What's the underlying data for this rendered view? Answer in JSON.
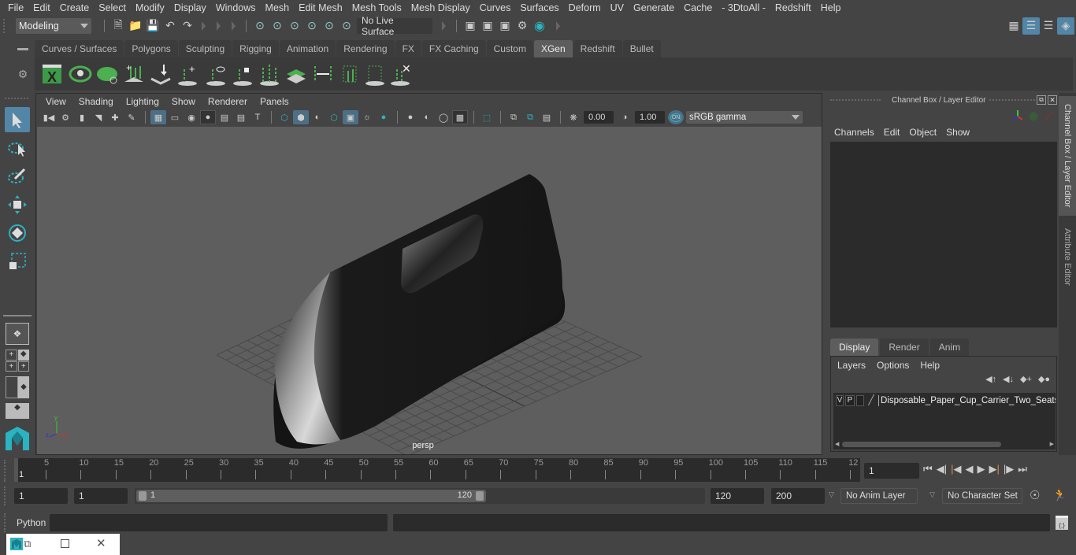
{
  "menubar": {
    "items": [
      "File",
      "Edit",
      "Create",
      "Select",
      "Modify",
      "Display",
      "Windows",
      "Mesh",
      "Edit Mesh",
      "Mesh Tools",
      "Mesh Display",
      "Curves",
      "Surfaces",
      "Deform",
      "UV",
      "Generate",
      "Cache",
      "- 3DtoAll -",
      "Redshift",
      "Help"
    ]
  },
  "statusline": {
    "mode": "Modeling",
    "live_surface": "No Live Surface"
  },
  "shelf": {
    "tabs": [
      "Curves / Surfaces",
      "Polygons",
      "Sculpting",
      "Rigging",
      "Animation",
      "Rendering",
      "FX",
      "FX Caching",
      "Custom",
      "XGen",
      "Redshift",
      "Bullet"
    ],
    "active_tab": "XGen",
    "icons": [
      "xgen-editor-icon",
      "xgen-preview-icon",
      "xgen-clear-preview-icon",
      "add-guides-icon",
      "place-guides-icon",
      "add-guide-icon",
      "toggle-guide-visibility-icon",
      "lock-guide-icon",
      "guide-mid-icon",
      "density-map-icon",
      "flip-guides-icon",
      "select-guides-icon",
      "guide-cv-icon",
      "delete-guides-icon"
    ]
  },
  "viewport": {
    "menu": [
      "View",
      "Shading",
      "Lighting",
      "Show",
      "Renderer",
      "Panels"
    ],
    "exposure": "0.00",
    "gamma": "1.00",
    "color_management": "ON",
    "color_space": "sRGB gamma",
    "camera_label": "persp",
    "axis": {
      "x": "x",
      "y": "y",
      "z": "z"
    }
  },
  "channel_box": {
    "title": "Channel Box / Layer Editor",
    "menu": [
      "Channels",
      "Edit",
      "Object",
      "Show"
    ]
  },
  "layer_editor": {
    "tabs": [
      "Display",
      "Render",
      "Anim"
    ],
    "active_tab": "Display",
    "menu": [
      "Layers",
      "Options",
      "Help"
    ],
    "layers": [
      {
        "v": "V",
        "p": "P",
        "name": "Disposable_Paper_Cup_Carrier_Two_Seats_I"
      }
    ]
  },
  "side_tabs": [
    "Channel Box / Layer Editor",
    "Attribute Editor"
  ],
  "timeline": {
    "ticks": [
      "5",
      "10",
      "15",
      "20",
      "25",
      "30",
      "35",
      "40",
      "45",
      "50",
      "55",
      "60",
      "65",
      "70",
      "75",
      "80",
      "85",
      "90",
      "95",
      "100",
      "105",
      "110",
      "115",
      "12"
    ],
    "current_frame_marker": "1",
    "current_frame": "1"
  },
  "range": {
    "start": "1",
    "playback_start": "1",
    "slider_start": "1",
    "slider_end": "120",
    "playback_end": "120",
    "end": "200",
    "anim_layer": "No Anim Layer",
    "character_set": "No Character Set"
  },
  "command_line": {
    "language": "Python"
  },
  "colors": {
    "accent": "#5285a6",
    "xgen_green": "#4caf50",
    "maya_teal": "#2ab3c0"
  }
}
